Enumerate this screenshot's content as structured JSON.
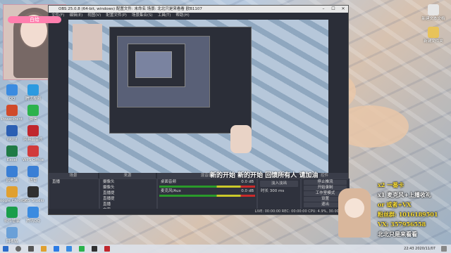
{
  "window": {
    "title": "OBS 25.0.8 (64-bit, windows)    配置文件: 未命名    场景: 北北只是来看看 欧B1107",
    "menu": [
      "文件(F)",
      "编辑(E)",
      "视图(V)",
      "配置文件(P)",
      "场景集合(S)",
      "工具(T)",
      "帮助(H)"
    ]
  },
  "docks": {
    "scenes_title": "场景",
    "sources_title": "来源",
    "mixer_title": "混音器",
    "transitions_title": "转场切换",
    "controls_title": "控件"
  },
  "scenes": [
    "直播"
  ],
  "sources": [
    "摄像头",
    "摄像头",
    "直播提",
    "直播提",
    "直播",
    "文字"
  ],
  "mixer": {
    "channels": [
      {
        "name": "桌面音频",
        "db": "0.0 dB"
      },
      {
        "name": "麦克风/Aux",
        "db": "0.0 dB"
      }
    ]
  },
  "transitions": {
    "selected": "淡入淡出",
    "duration_label": "时长",
    "duration": "300 ms"
  },
  "controls": [
    "停止推流",
    "开始录制",
    "工作室模式",
    "设置",
    "退出"
  ],
  "status": "LIVE: 00:00:00   REC: 00:00:00   CPU: 4.9%, 30.00 fps",
  "webcam_label": "白给",
  "overlay": {
    "top_line": "新的开始 新的开始 回馈所有人 请加油",
    "lines": [
      {
        "text": "x2 一番卡",
        "color": "#ffe23a"
      },
      {
        "text": "x1 麦克风+上播收礼",
        "color": "#ffffff"
      },
      {
        "text": "or 或者+VX",
        "color": "#ffe23a"
      },
      {
        "text": "粉丝群: 1016189501",
        "color": "#ffe23a"
      },
      {
        "text": "VX: 357956558",
        "color": "#ffe23a"
      },
      {
        "text": "北北只是来看看",
        "color": "#ffffff"
      }
    ]
  },
  "desktop_icons_left": [
    {
      "label": "QQ",
      "color": "#3b8be0"
    },
    {
      "label": "PowerPoint",
      "color": "#d04a2a"
    },
    {
      "label": "Word",
      "color": "#2b5fb3"
    },
    {
      "label": "Excel",
      "color": "#1f7a45"
    },
    {
      "label": "此电脑",
      "color": "#3a7fd5"
    },
    {
      "label": "Google Chrome",
      "color": "#e0a030"
    },
    {
      "label": "软件管家",
      "color": "#1a9e4b"
    },
    {
      "label": "回收站",
      "color": "#6aa0d8"
    }
  ],
  "desktop_icons_left2": [
    {
      "label": "腾讯视频",
      "color": "#2c9ae0"
    },
    {
      "label": "微信",
      "color": "#2bb24c"
    },
    {
      "label": "网易云音乐",
      "color": "#c0262c"
    },
    {
      "label": "WPS Office",
      "color": "#d13b3b"
    },
    {
      "label": "迅雷",
      "color": "#3a7fd5"
    },
    {
      "label": "OBS Studio",
      "color": "#303030"
    },
    {
      "label": "腾讯QQ",
      "color": "#3b8be0"
    }
  ],
  "desktop_icons_right": [
    {
      "label": "新建文本文档",
      "color": "#e6e6e6"
    },
    {
      "label": "新建文件夹",
      "color": "#e8c35a"
    }
  ],
  "taskbar": {
    "time": "22:43",
    "date": "2020/11/07"
  }
}
